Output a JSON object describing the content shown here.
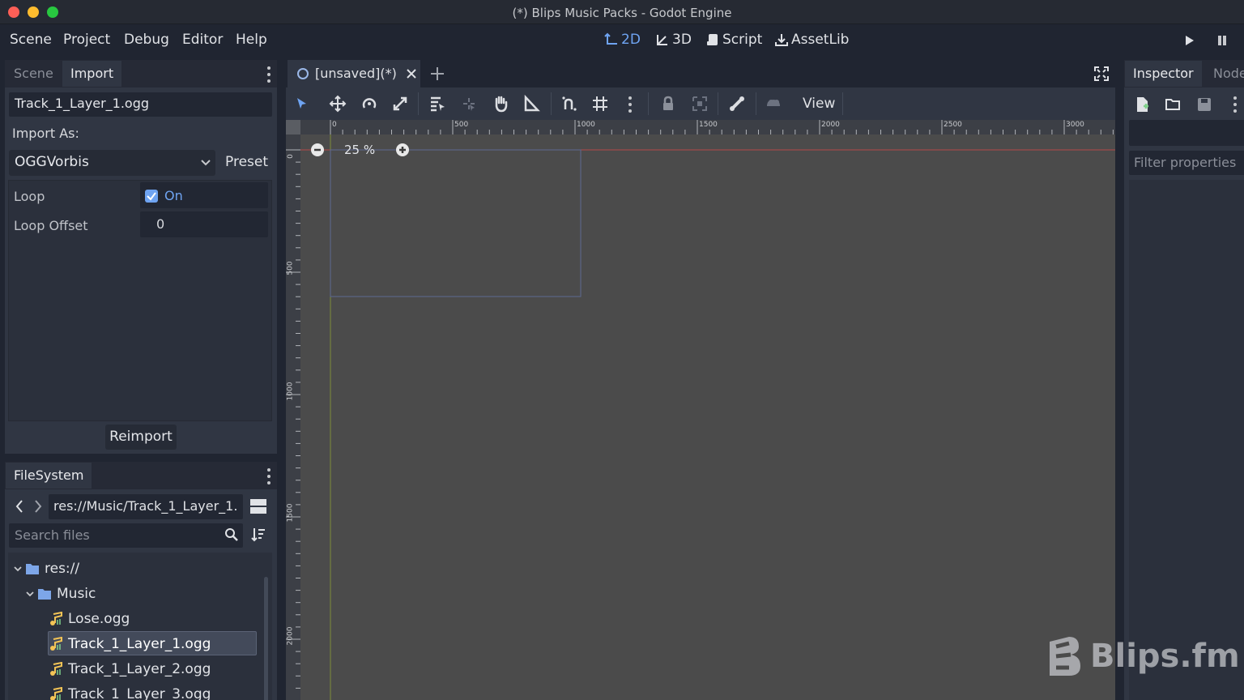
{
  "window": {
    "title": "(*) Blips Music Packs - Godot Engine"
  },
  "menu": {
    "items": [
      "Scene",
      "Project",
      "Debug",
      "Editor",
      "Help"
    ]
  },
  "workspaces": {
    "items": [
      "2D",
      "3D",
      "Script",
      "AssetLib"
    ],
    "active": "2D"
  },
  "left_top_panel": {
    "tabs": [
      "Scene",
      "Import"
    ],
    "active_tab": "Import",
    "file_name": "Track_1_Layer_1.ogg",
    "import_as_label": "Import As:",
    "import_type": "OGGVorbis",
    "preset_label": "Preset",
    "properties": [
      {
        "name": "Loop",
        "value": "On",
        "checked": true
      },
      {
        "name": "Loop Offset",
        "value": "0"
      }
    ],
    "reimport_label": "Reimport"
  },
  "filesystem": {
    "tab": "FileSystem",
    "path": "res://Music/Track_1_Layer_1.",
    "search_placeholder": "Search files",
    "tree": [
      {
        "label": "res://",
        "type": "folder",
        "depth": 0,
        "expanded": true
      },
      {
        "label": "Music",
        "type": "folder",
        "depth": 1,
        "expanded": true
      },
      {
        "label": "Lose.ogg",
        "type": "audio",
        "depth": 2
      },
      {
        "label": "Track_1_Layer_1.ogg",
        "type": "audio",
        "depth": 2,
        "selected": true
      },
      {
        "label": "Track_1_Layer_2.ogg",
        "type": "audio",
        "depth": 2
      },
      {
        "label": "Track_1_Layer_3.ogg",
        "type": "audio",
        "depth": 2
      }
    ]
  },
  "scene_tabs": {
    "items": [
      "[unsaved](*)"
    ]
  },
  "viewport": {
    "view_menu": "View",
    "zoom": "25 %",
    "ruler_h_labels": [
      "0",
      "500",
      "1000",
      "1500",
      "2000",
      "2500",
      "3000"
    ],
    "ruler_v_labels": [
      "0",
      "500",
      "1000",
      "1500",
      "2000"
    ]
  },
  "inspector": {
    "tabs": [
      "Inspector",
      "Node"
    ],
    "active_tab": "Inspector",
    "filter_placeholder": "Filter properties"
  },
  "watermark": {
    "text": "Blips.fm"
  },
  "colors": {
    "accent": "#6fa4f2",
    "bg_dark": "#202531",
    "panel": "#303643",
    "viewport": "#4b4b4b",
    "audio_icon": "#f3c456"
  }
}
